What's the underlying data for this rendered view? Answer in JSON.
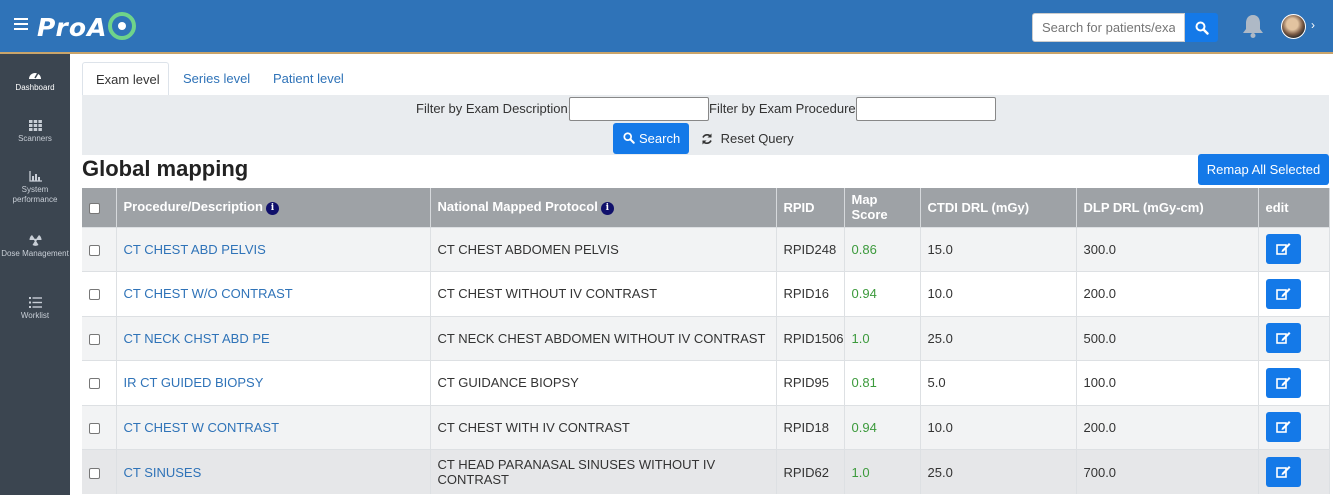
{
  "app": {
    "logo_text": "ProAC"
  },
  "topbar": {
    "search_placeholder": "Search for patients/exams",
    "colors": {
      "bar": "#2f73b8",
      "accent": "#1479e8"
    }
  },
  "sidebar": {
    "items": [
      {
        "label": "Dashboard",
        "icon": "dashboard-icon"
      },
      {
        "label": "Scanners",
        "icon": "grid-icon"
      },
      {
        "label": "System performance",
        "icon": "bar-chart-icon"
      },
      {
        "label": "Dose Management",
        "icon": "radiation-icon"
      },
      {
        "label": "Worklist",
        "icon": "list-icon"
      }
    ]
  },
  "tabs": [
    {
      "label": "Exam level",
      "active": true
    },
    {
      "label": "Series level",
      "active": false
    },
    {
      "label": "Patient level",
      "active": false
    }
  ],
  "filter": {
    "description_label": "Filter by Exam Description:",
    "description_value": "",
    "procedure_label": "Filter by Exam Procedure:",
    "procedure_value": "",
    "search_label": "Search",
    "reset_label": "Reset Query"
  },
  "page": {
    "title": "Global mapping",
    "remap_label": "Remap All Selected"
  },
  "table": {
    "columns": [
      "Procedure/Description",
      "National Mapped Protocol",
      "RPID",
      "Map Score",
      "CTDI DRL (mGy)",
      "DLP DRL (mGy-cm)",
      "edit"
    ],
    "rows": [
      {
        "procedure": "CT CHEST ABD PELVIS",
        "protocol": "CT CHEST ABDOMEN PELVIS",
        "rpid": "RPID248",
        "score": "0.86",
        "ctdi": "15.0",
        "dlp": "300.0"
      },
      {
        "procedure": "CT CHEST W/O CONTRAST",
        "protocol": "CT CHEST WITHOUT IV CONTRAST",
        "rpid": "RPID16",
        "score": "0.94",
        "ctdi": "10.0",
        "dlp": "200.0"
      },
      {
        "procedure": "CT NECK CHST ABD PE",
        "protocol": "CT NECK CHEST ABDOMEN WITHOUT IV CONTRAST",
        "rpid": "RPID1506",
        "score": "1.0",
        "ctdi": "25.0",
        "dlp": "500.0"
      },
      {
        "procedure": "IR CT GUIDED BIOPSY",
        "protocol": "CT GUIDANCE BIOPSY",
        "rpid": "RPID95",
        "score": "0.81",
        "ctdi": "5.0",
        "dlp": "100.0"
      },
      {
        "procedure": "CT CHEST W CONTRAST",
        "protocol": "CT CHEST WITH IV CONTRAST",
        "rpid": "RPID18",
        "score": "0.94",
        "ctdi": "10.0",
        "dlp": "200.0"
      },
      {
        "procedure": "CT SINUSES",
        "protocol": "CT HEAD PARANASAL SINUSES WITHOUT IV CONTRAST",
        "rpid": "RPID62",
        "score": "1.0",
        "ctdi": "25.0",
        "dlp": "700.0"
      }
    ]
  }
}
